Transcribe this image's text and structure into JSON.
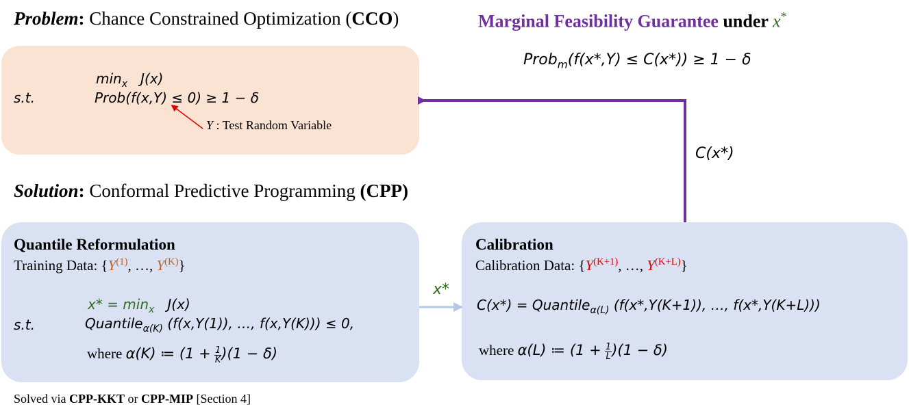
{
  "problem": {
    "label": "Problem",
    "title": "Chance Constrained Optimization (",
    "abbr": "CCO",
    "close": ")"
  },
  "cco_box": {
    "objective": "min",
    "objective_sub": "x",
    "objective_fn": "J(x)",
    "st": "s.t.",
    "constraint": "Prob(f(x,Y) ≤ 0) ≥ 1 − δ",
    "annotation_var": "Y",
    "annotation_text": ": Test Random Variable"
  },
  "guarantee": {
    "title_colored": "Marginal Feasibility Guarantee",
    "under": "under",
    "var": "x",
    "formula_prefix": "Prob",
    "formula_sub": "m",
    "formula_rest": "(f(x*,Y) ≤ C(x*)) ≥ 1 − δ"
  },
  "edge_label": "C(x*)",
  "solution": {
    "label": "Solution",
    "title": "Conformal Predictive Programming ",
    "abbr": "CPP"
  },
  "quantile_box": {
    "heading": "Quantile Reformulation",
    "training_label": "Training Data: {",
    "training_y1": "Y",
    "training_y1_sup": "(1)",
    "training_mid": ", …, ",
    "training_yk": "Y",
    "training_yk_sup": "(K)",
    "training_close": "}",
    "line1": "x* = min",
    "line1_sub": "x",
    "line1_fn": "J(x)",
    "st": "s.t.",
    "quantile": "Quantile",
    "quantile_sub": "α(K)",
    "quantile_args": "(f(x,Y(1)), …, f(x,Y(K))) ≤ 0,",
    "where": "where",
    "where_expr_a": "α(K) ≔ (1 +",
    "frac_num": "1",
    "frac_den": "K",
    "where_expr_b": ")(1 − δ)"
  },
  "arrow_label": "x*",
  "calibration_box": {
    "heading": "Calibration",
    "data_label": "Calibration Data: {",
    "data_y1_sup": "(K+1)",
    "data_y2_sup": "(K+L)",
    "data_close": "}",
    "formula": "C(x*) = Quantile",
    "formula_sub": "α(L)",
    "formula_args": "(f(x*,Y(K+1)), …, f(x*,Y(K+L)))",
    "where": "where",
    "where_expr_a": "α(L) ≔ (1 +",
    "frac_num": "1",
    "frac_den": "L",
    "where_expr_b": ")(1 − δ)"
  },
  "footer": {
    "prefix": "Solved via ",
    "m1": "CPP-KKT",
    "or": " or ",
    "m2": "CPP-MIP",
    "suffix": " [Section 4]"
  },
  "colors": {
    "peach_box": "#fbe3d4",
    "blue_box": "#d9e1f2",
    "purple": "#7030a0",
    "green": "#2e6b1f",
    "orange": "#c0601f",
    "red": "#e00000"
  }
}
